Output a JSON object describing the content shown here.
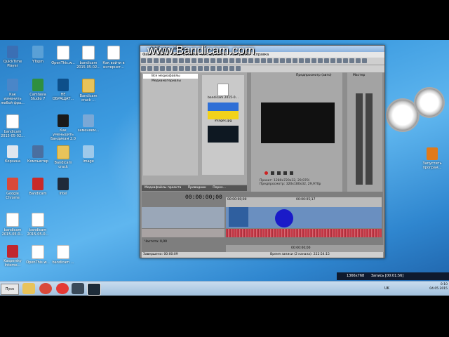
{
  "watermark": "www.Bandicam.com",
  "desktop_icons": [
    {
      "label": "QuickTime Player",
      "kind": "app",
      "color": "#3b6fb4"
    },
    {
      "label": "YTopm",
      "kind": "app",
      "color": "#5aa0d6"
    },
    {
      "label": "OpenThis.w...",
      "kind": "doc",
      "color": "#ffffff"
    },
    {
      "label": "bandicam 2015-05-02...",
      "kind": "doc",
      "color": "#ffffff"
    },
    {
      "label": "Как войти в интернет...",
      "kind": "doc",
      "color": "#ffffff"
    },
    {
      "label": "Как изменить любой фра...",
      "kind": "app",
      "color": "#4a86c8"
    },
    {
      "label": "Camtasia Studio 7",
      "kind": "app",
      "color": "#2f8f3f"
    },
    {
      "label": "НЕ ОБРАЩАТ...",
      "kind": "app",
      "color": "#0d4f8a"
    },
    {
      "label": "Bandicam crack ...",
      "kind": "folder",
      "color": "#e8c35a"
    },
    {
      "label": "bandicam 2015-05-02...",
      "kind": "doc",
      "color": "#ffffff"
    },
    {
      "label": "Как уменьшить Бандикам 2.0",
      "kind": "app",
      "color": "#1a1a1a"
    },
    {
      "label": "заменяем... ",
      "kind": "app",
      "color": "#7aa8d6"
    },
    {
      "label": "Корзина",
      "kind": "app",
      "color": "#dfe6ee"
    },
    {
      "label": "Компьютер",
      "kind": "app",
      "color": "#4a6fa0"
    },
    {
      "label": "Bandicam crack",
      "kind": "folder",
      "color": "#e8c35a"
    },
    {
      "label": "image",
      "kind": "app",
      "color": "#9ec9ea"
    },
    {
      "label": "Google Chrome",
      "kind": "app",
      "color": "#d94a3a"
    },
    {
      "label": "Bandicam",
      "kind": "app",
      "color": "#c92a2a"
    },
    {
      "label": "Intel",
      "kind": "app",
      "color": "#1f2a3a"
    },
    {
      "label": "bandicam 2015-05-0...",
      "kind": "doc",
      "color": "#ffffff"
    },
    {
      "label": "bandicam 2015-05-0...",
      "kind": "doc",
      "color": "#ffffff"
    },
    {
      "label": "Kaspersky Interne...",
      "kind": "app",
      "color": "#c0262e"
    },
    {
      "label": "OpenThis.w...",
      "kind": "doc",
      "color": "#ffffff"
    },
    {
      "label": "bandicam ...",
      "kind": "doc",
      "color": "#ffffff"
    }
  ],
  "right_icon": {
    "label": "Запустить програм...",
    "color": "#e07a1a"
  },
  "vegas": {
    "title": "QWE.veg - Vegas",
    "menu": [
      "Файл",
      "Правка",
      "Вид",
      "Вставка",
      "Инструменты",
      "Настройки",
      "Справка"
    ],
    "tree": [
      "Все медиафайлы",
      "Медиаматериалы"
    ],
    "files": [
      {
        "label": "bandicam 2015-0..."
      },
      {
        "label": "images.jpg"
      },
      {
        "label": ""
      }
    ],
    "media_tabs": [
      "Медиафайлы проекта",
      "Проводник",
      "Перех..."
    ],
    "preview_label": "Предпросмотр (авто)",
    "preview_info": [
      "Проект: 1280х720х32, 29,970i",
      "Предпросмотр: 320х180х32, 29,970p",
      "Кадр: 0",
      "Отобразить: 222х125х32"
    ],
    "mixer_label": "Мастер",
    "meter_ticks": [
      "-3",
      "-6",
      "-9",
      "-12",
      "-15",
      "-18",
      "-21",
      "-24",
      "-27",
      "-30",
      "-33",
      "-36",
      "-39",
      "-42",
      "-45",
      "-48",
      "-51",
      "-54",
      "-57"
    ],
    "meter_readout": [
      "0,0",
      "0,0"
    ],
    "timecode": "00:00:00;00",
    "ruler": [
      "00:00:00;00",
      "00:00:05;17"
    ],
    "rate_label": "Частота: 0,00",
    "transport_time": "00:00:00;00",
    "status_left": "Завершено: 00:00:09",
    "status_right": "Время записи (2 канала): 222:54:15"
  },
  "notify_bar": {
    "resolution": "1366x768",
    "record": "Запись [00:01:56]"
  },
  "taskbar": {
    "start": "Пуск",
    "lang": "UK",
    "time": "0:10",
    "date": "04.05.2015"
  }
}
